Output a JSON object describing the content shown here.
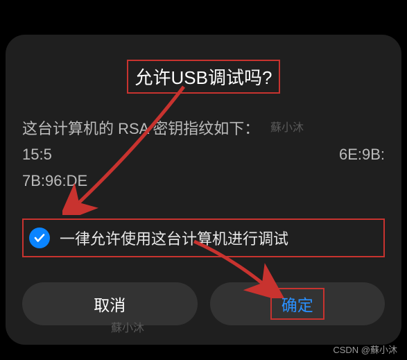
{
  "dialog": {
    "title": "允许USB调试吗?",
    "fingerprint_intro": "这台计算机的 RSA 密钥指纹如下：",
    "fingerprint_left": "15:5",
    "fingerprint_right": "6E:9B:",
    "fingerprint_line3": "7B:96:DE",
    "checkbox_label": "一律允许使用这台计算机进行调试",
    "cancel_label": "取消",
    "ok_label": "确定"
  },
  "watermarks": {
    "wm1": "蘇小沐",
    "wm2": "蘇小沐"
  },
  "footer": {
    "credit": "CSDN @蘇小沐"
  },
  "colors": {
    "annotation": "#c8332f",
    "accent": "#0a84ff",
    "ok_text": "#2a90ff"
  }
}
